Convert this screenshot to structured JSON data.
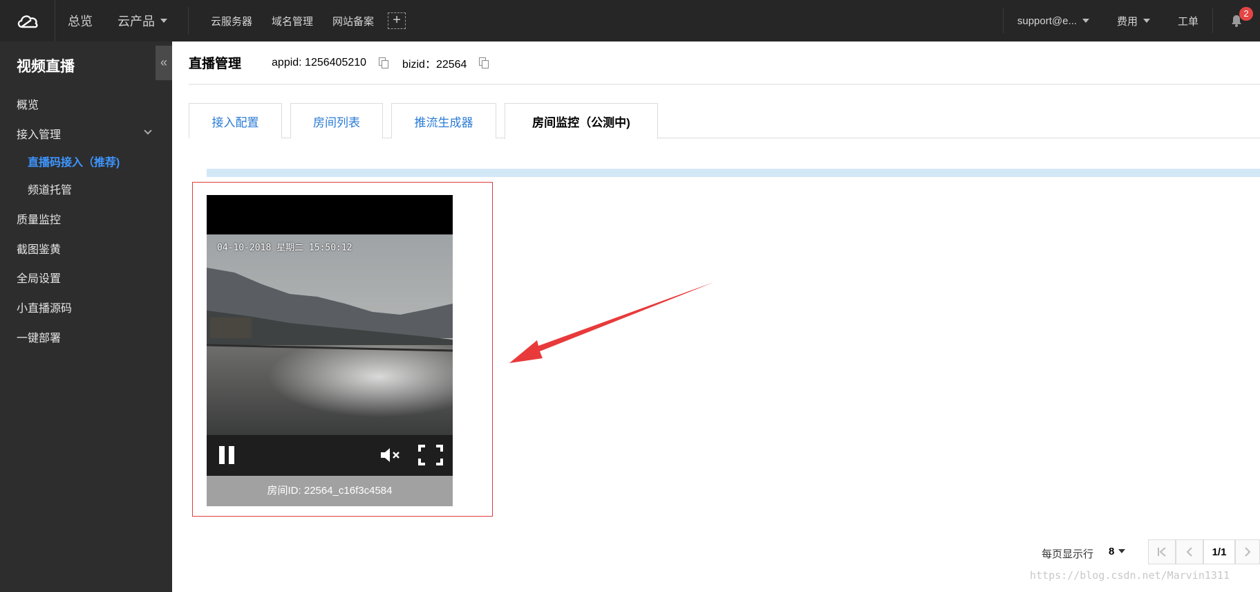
{
  "topbar": {
    "logo_icon": "cloud-logo-icon",
    "overview": "总览",
    "products": "云产品",
    "links": [
      "云服务器",
      "域名管理",
      "网站备案"
    ],
    "add_label": "+",
    "account": "support@e...",
    "billing": "费用",
    "tickets": "工单",
    "notification_count": "2"
  },
  "sidebar": {
    "title": "视频直播",
    "collapse_label": "«",
    "items": [
      {
        "label": "概览"
      },
      {
        "label": "接入管理"
      },
      {
        "label": "直播码接入（推荐)"
      },
      {
        "label": "频道托管"
      },
      {
        "label": "质量监控"
      },
      {
        "label": "截图鉴黄"
      },
      {
        "label": "全局设置"
      },
      {
        "label": "小直播源码"
      },
      {
        "label": "一键部署"
      }
    ]
  },
  "main": {
    "title": "直播管理",
    "appid": "appid: 1256405210",
    "bizid": "bizid：22564",
    "tabs": [
      {
        "label": "接入配置"
      },
      {
        "label": "房间列表"
      },
      {
        "label": "推流生成器"
      },
      {
        "label": "房间监控（公测中)"
      }
    ],
    "active_tab": "房间监控（公测中)",
    "player": {
      "timestamp": "04-10-2018 星期二 15:50:12",
      "room_id": "房间ID: 22564_c16f3c4584",
      "state": "playing",
      "muted": true
    },
    "pager": {
      "rows_label": "每页显示行",
      "rows_value": "8",
      "page": "1/1"
    }
  },
  "watermark": "https://blog.csdn.net/Marvin1311",
  "colors": {
    "topbar_bg": "#262626",
    "sidebar_bg": "#2d2d2d",
    "accent": "#2b7bd6",
    "active_nav": "#3e95ff",
    "highlight": "#e23a3a"
  }
}
